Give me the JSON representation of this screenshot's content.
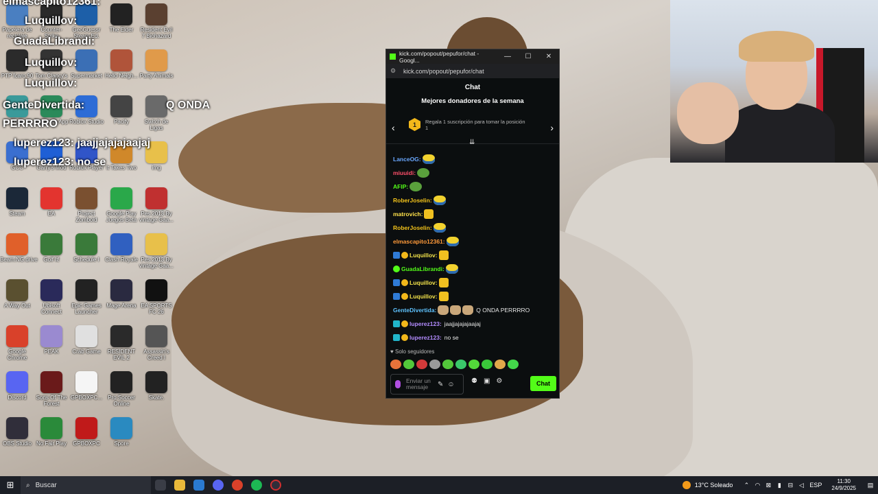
{
  "desktop": {
    "icons": [
      {
        "label": "Papelera de reciclaje",
        "color": "#4a7fc1"
      },
      {
        "label": "Counter-Strike",
        "color": "#2a2a2a"
      },
      {
        "label": "GeoGuessr Steam Ed.",
        "color": "#1d5fa8"
      },
      {
        "label": "The Elder",
        "color": "#222"
      },
      {
        "label": "Resident Evil 7 Biohazard",
        "color": "#5a4030"
      },
      {
        "label": "PTP Ícaro 90",
        "color": "#2b2b2b"
      },
      {
        "label": "Tom Clancy's",
        "color": "#333"
      },
      {
        "label": "Supermarket",
        "color": "#3b6fb5"
      },
      {
        "label": "Hello Neigh...",
        "color": "#b0543a"
      },
      {
        "label": "Party Animals",
        "color": "#e09a4a"
      },
      {
        "label": "Luge",
        "color": "#3a9a9a"
      },
      {
        "label": "Labyrinth App",
        "color": "#2a8a5a"
      },
      {
        "label": "Roblox Studio",
        "color": "#2d6cd6"
      },
      {
        "label": "Pacify",
        "color": "#444"
      },
      {
        "label": "Switch de Ligas",
        "color": "#6a6a6a"
      },
      {
        "label": "GCC",
        "color": "#3a6fd0"
      },
      {
        "label": "Garry's Mod",
        "color": "#1f5fd5"
      },
      {
        "label": "Roblox Player",
        "color": "#3055c8"
      },
      {
        "label": "It Takes Two",
        "color": "#d0882a"
      },
      {
        "label": "img",
        "color": "#e8c04a"
      },
      {
        "label": "Steam",
        "color": "#1b2838"
      },
      {
        "label": "EA",
        "color": "#e3342f"
      },
      {
        "label": "Project Zomboid",
        "color": "#7a5030"
      },
      {
        "label": "Google Play Juegos Beta",
        "color": "#2aa84a"
      },
      {
        "label": "Pes 2013 By vintage Gaa...",
        "color": "#c03030"
      },
      {
        "label": "Beam.NG.drive",
        "color": "#e0602a"
      },
      {
        "label": "Golf It!",
        "color": "#3a7a3a"
      },
      {
        "label": "Schedule I",
        "color": "#3a7a3a"
      },
      {
        "label": "Clash Royale",
        "color": "#3060c0"
      },
      {
        "label": "Pes 2013 By vintage Gaa...",
        "color": "#e8c04a"
      },
      {
        "label": "A Way Out",
        "color": "#5a5030"
      },
      {
        "label": "Ubisoft Connect",
        "color": "#2a2a5a"
      },
      {
        "label": "Epic Games Launcher",
        "color": "#222"
      },
      {
        "label": "Mage Arena",
        "color": "#2a2a40"
      },
      {
        "label": "EA SPORTS FC 26",
        "color": "#111"
      },
      {
        "label": "Google Chrome",
        "color": "#d9412a"
      },
      {
        "label": "PEAK",
        "color": "#9a8ad0"
      },
      {
        "label": "Crab Game",
        "color": "#e0e0e0"
      },
      {
        "label": "RESIDENT EVIL 2",
        "color": "#2a2a2a"
      },
      {
        "label": "Assassin's Creed I",
        "color": "#555"
      },
      {
        "label": "Discord",
        "color": "#5865f2"
      },
      {
        "label": "Sons Of The Forest",
        "color": "#6a1a1a"
      },
      {
        "label": "GPBOXPC...",
        "color": "#f5f5f5"
      },
      {
        "label": "Pro Soccer Online",
        "color": "#222"
      },
      {
        "label": "Skate.",
        "color": "#222"
      },
      {
        "label": "OBS Studio",
        "color": "#302e3a"
      },
      {
        "label": "No Fair Play",
        "color": "#2a8a3a"
      },
      {
        "label": "GPBOXPC",
        "color": "#c01a1a"
      },
      {
        "label": "Spore",
        "color": "#2a8ac0"
      }
    ],
    "overlays": [
      {
        "text": "elmascapito12361:"
      },
      {
        "text": "Luquillov:"
      },
      {
        "text": "GuadaLibrandi:"
      },
      {
        "text": "Luquillov:"
      },
      {
        "text": "Luquillov:"
      },
      {
        "text": "GenteDivertida:"
      },
      {
        "text": "Q ONDA"
      },
      {
        "text": "PERRRRO"
      },
      {
        "text": "luperez123: jaajjajajajaajaj"
      },
      {
        "text": "luperez123: no se"
      }
    ]
  },
  "window": {
    "title": "kick.com/popout/pepufor/chat - Googl...",
    "url": "kick.com/popout/pepufor/chat",
    "controls": {
      "minimize": "—",
      "maximize": "☐",
      "close": "✕"
    }
  },
  "chat": {
    "header": "Chat",
    "donors": {
      "title": "Mejores donadores de la semana",
      "rank": "1",
      "text": "Regala 1 suscripción para tomar la posición 1",
      "prev": "‹",
      "next": "›"
    },
    "messages": [
      {
        "user": "LanceOG:",
        "color": "#6aa8ff",
        "badges": [],
        "text": "",
        "emotes": [
          "minion"
        ]
      },
      {
        "user": "miuuidi:",
        "color": "#ff4f6a",
        "badges": [],
        "text": "",
        "emotes": [
          "pepe"
        ]
      },
      {
        "user": "AFIP:",
        "color": "#53fc18",
        "badges": [],
        "text": "",
        "emotes": [
          "pepe"
        ]
      },
      {
        "user": "RoberJoselin:",
        "color": "#f3c31a",
        "badges": [],
        "text": "",
        "emotes": [
          "minion"
        ]
      },
      {
        "user": "matrovich:",
        "color": "#ffe14a",
        "badges": [],
        "text": "",
        "emotes": [
          "thumb"
        ]
      },
      {
        "user": "RoberJoselin:",
        "color": "#f3c31a",
        "badges": [],
        "text": "",
        "emotes": [
          "minion"
        ]
      },
      {
        "user": "elmascapito12361:",
        "color": "#ff9a3a",
        "badges": [],
        "text": "",
        "emotes": [
          "minion"
        ]
      },
      {
        "user": "Luquillov:",
        "color": "#f3e34a",
        "badges": [
          "blue",
          "gold"
        ],
        "text": "",
        "emotes": [
          "thumb"
        ]
      },
      {
        "user": "GuadaLibrandi:",
        "color": "#53fc18",
        "badges": [
          "green"
        ],
        "text": "",
        "emotes": [
          "minion"
        ]
      },
      {
        "user": "Luquillov:",
        "color": "#f3e34a",
        "badges": [
          "blue",
          "gold"
        ],
        "text": "",
        "emotes": [
          "thumb"
        ]
      },
      {
        "user": "Luquillov:",
        "color": "#f3e34a",
        "badges": [
          "blue",
          "gold"
        ],
        "text": "",
        "emotes": [
          "thumb"
        ]
      },
      {
        "user": "GenteDivertida:",
        "color": "#5fc3ff",
        "badges": [],
        "text": "Q ONDA PERRRRO",
        "emotes": [
          "cat",
          "cat",
          "cat"
        ]
      },
      {
        "user": "luperez123:",
        "color": "#b48cff",
        "badges": [
          "teal",
          "gold"
        ],
        "text": "jaajjajajajaajaj",
        "emotes": []
      },
      {
        "user": "luperez123:",
        "color": "#b48cff",
        "badges": [
          "teal",
          "gold"
        ],
        "text": "no se",
        "emotes": []
      }
    ],
    "followers_only": "Solo seguidores",
    "input_placeholder": "Enviar un mensaje",
    "send_label": "Chat"
  },
  "taskbar": {
    "search_placeholder": "Buscar",
    "weather": "13°C Soleado",
    "language": "ESP",
    "time": "11:30",
    "date": "24/9/2025"
  }
}
